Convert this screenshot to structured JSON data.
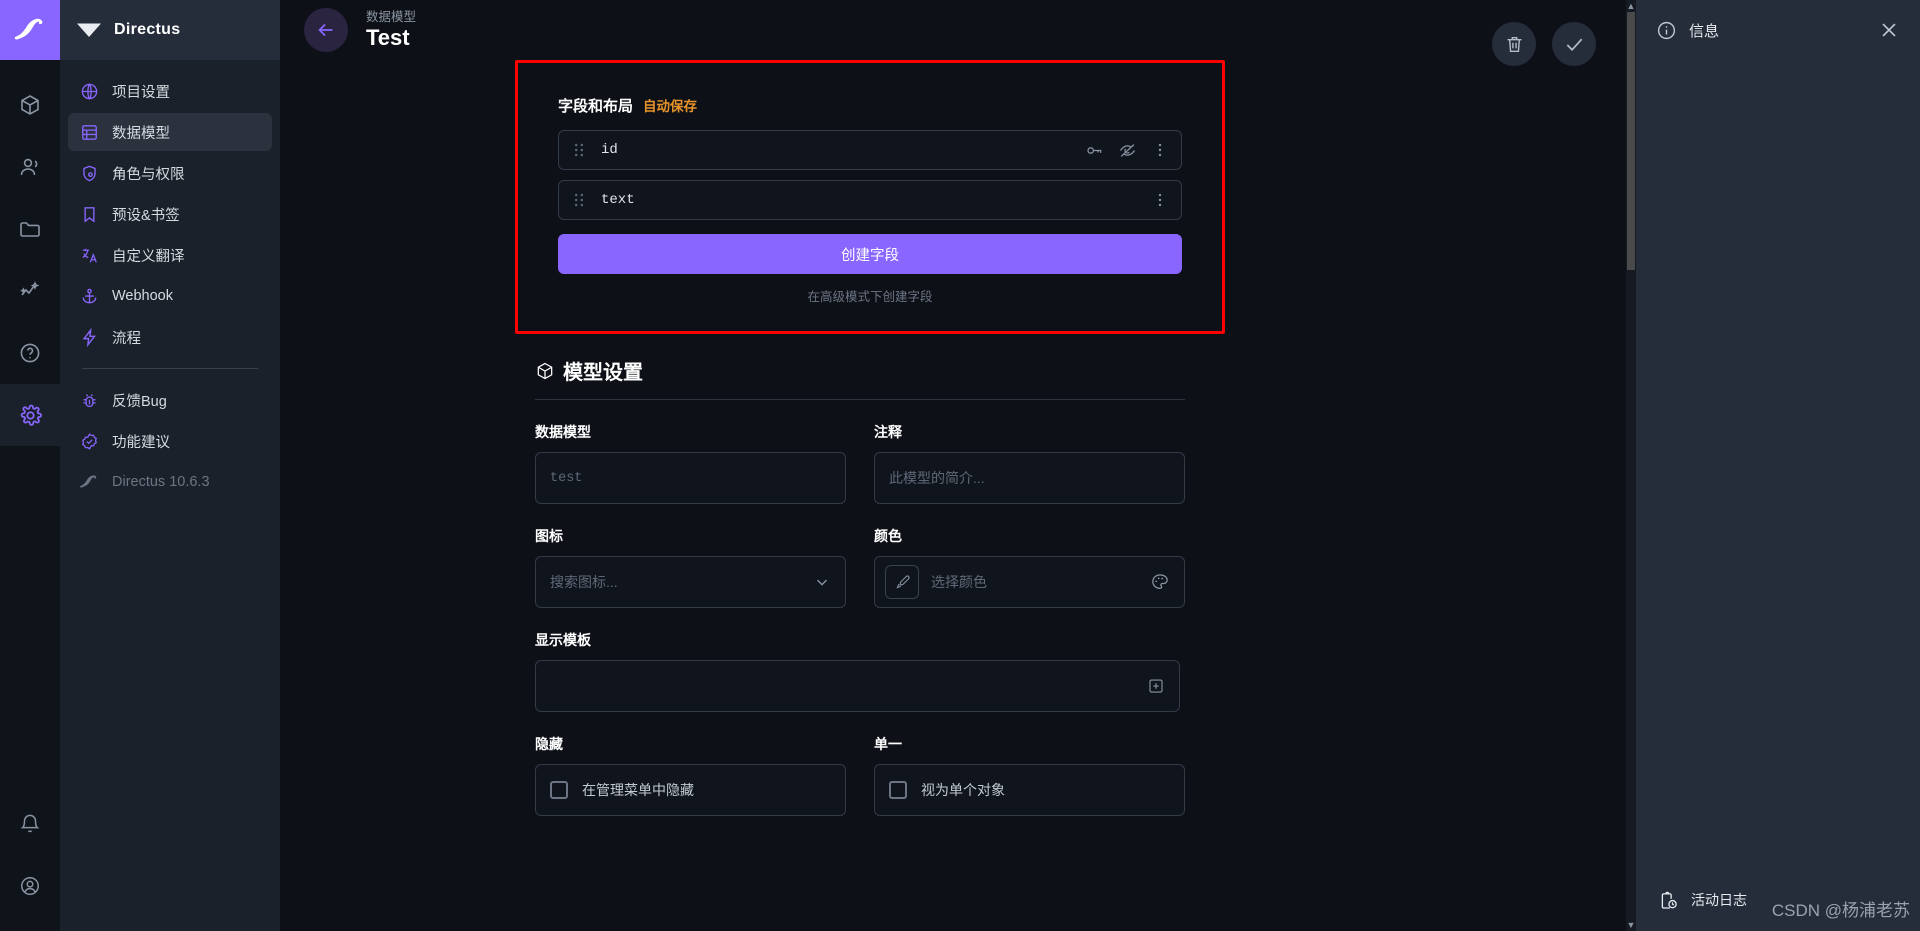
{
  "brand": {
    "name": "Directus",
    "accent": "#8866ff",
    "highlight_border": "#ff0000",
    "auto_save_color": "#e8932a"
  },
  "rail": {
    "items": [
      {
        "name": "content",
        "icon": "box-icon"
      },
      {
        "name": "users",
        "icon": "users-icon"
      },
      {
        "name": "files",
        "icon": "folder-icon"
      },
      {
        "name": "insights",
        "icon": "insights-icon"
      },
      {
        "name": "help",
        "icon": "help-icon"
      }
    ],
    "bottom": [
      {
        "name": "notifications",
        "icon": "bell-icon"
      },
      {
        "name": "account",
        "icon": "account-icon"
      }
    ],
    "settings": {
      "name": "settings",
      "icon": "gear-icon",
      "active": true
    }
  },
  "sidebar": {
    "title": "Directus",
    "items": [
      {
        "label": "项目设置",
        "icon": "globe-icon",
        "active": false
      },
      {
        "label": "数据模型",
        "icon": "table-icon",
        "active": true
      },
      {
        "label": "角色与权限",
        "icon": "shield-icon",
        "active": false
      },
      {
        "label": "预设&书签",
        "icon": "bookmark-icon",
        "active": false
      },
      {
        "label": "自定义翻译",
        "icon": "translate-icon",
        "active": false
      },
      {
        "label": "Webhook",
        "icon": "anchor-icon",
        "active": false
      },
      {
        "label": "流程",
        "icon": "bolt-icon",
        "active": false
      }
    ],
    "footer_items": [
      {
        "label": "反馈Bug",
        "icon": "bug-icon",
        "muted": false
      },
      {
        "label": "功能建议",
        "icon": "badge-check-icon",
        "muted": false
      },
      {
        "label": "Directus 10.6.3",
        "icon": "directus-logo-icon",
        "muted": true
      }
    ]
  },
  "header": {
    "breadcrumb": "数据模型",
    "title": "Test",
    "back_icon": "arrow-left-icon",
    "actions": [
      {
        "name": "delete-button",
        "icon": "trash-icon"
      },
      {
        "name": "save-button",
        "icon": "check-icon"
      }
    ]
  },
  "fields_panel": {
    "title": "字段和布局",
    "auto_save_label": "自动保存",
    "rows": [
      {
        "name": "id",
        "icons": [
          "key-icon",
          "eye-off-icon",
          "more-vertical-icon"
        ]
      },
      {
        "name": "text",
        "icons": [
          "more-vertical-icon"
        ]
      }
    ],
    "create_button": "创建字段",
    "advanced_note": "在高级模式下创建字段"
  },
  "settings_section": {
    "title": "模型设置",
    "icon": "box-icon",
    "fields": {
      "collection": {
        "label": "数据模型",
        "value": "",
        "placeholder": "test"
      },
      "note": {
        "label": "注释",
        "value": "",
        "placeholder": "此模型的简介..."
      },
      "icon": {
        "label": "图标",
        "value": "",
        "placeholder": "搜索图标...",
        "chevron": "chevron-down-icon"
      },
      "color": {
        "label": "颜色",
        "value": "",
        "placeholder": "选择颜色",
        "swatch_icon": "eyedropper-icon",
        "palette_icon": "palette-icon"
      },
      "display_template": {
        "label": "显示模板",
        "value": "",
        "placeholder": "",
        "add_icon": "add-box-icon"
      },
      "hidden": {
        "label": "隐藏",
        "checkbox_label": "在管理菜单中隐藏",
        "checked": false
      },
      "singleton": {
        "label": "单一",
        "checkbox_label": "视为单个对象",
        "checked": false
      }
    }
  },
  "drawer": {
    "title": "信息",
    "info_icon": "info-icon",
    "close_icon": "close-icon",
    "footer": {
      "label": "活动日志",
      "icon": "clipboard-clock-icon"
    }
  },
  "watermark": "CSDN @杨浦老苏"
}
